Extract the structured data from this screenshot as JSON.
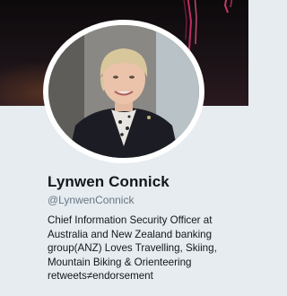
{
  "profile": {
    "display_name": "Lynwen Connick",
    "handle": "@LynwenConnick",
    "bio": "Chief Information Security Officer at\nAustralia and New Zealand banking\ngroup(ANZ) Loves Travelling, Skiing,\nMountain Biking & Orienteering\nretweets≠endorsement"
  },
  "colors": {
    "page_background": "#e6ecf0",
    "name_text": "#14171a",
    "handle_text": "#657786",
    "banner": "#0d0a0c"
  },
  "icons": {
    "avatar": "profile-photo"
  }
}
